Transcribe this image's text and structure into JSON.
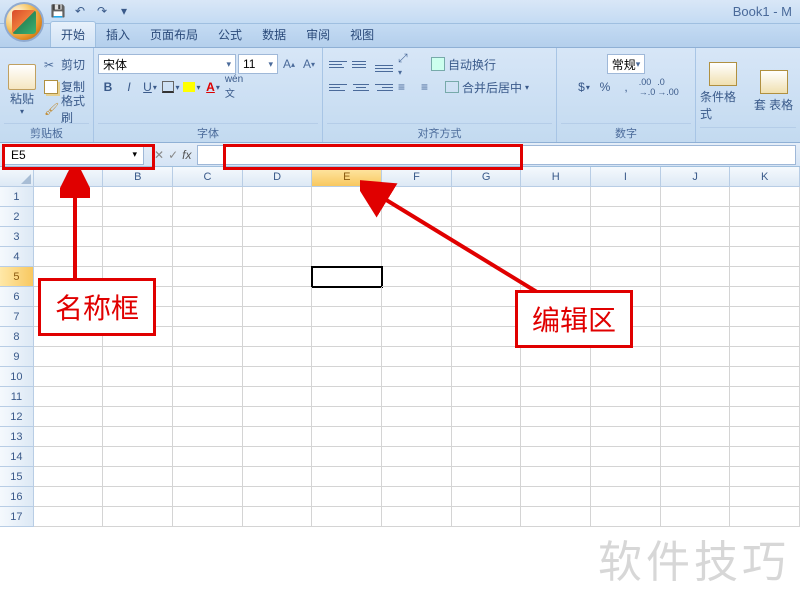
{
  "title": "Book1 - M",
  "tabs": [
    "开始",
    "插入",
    "页面布局",
    "公式",
    "数据",
    "审阅",
    "视图"
  ],
  "clipboard": {
    "cut": "剪切",
    "copy": "复制",
    "format_painter": "格式刷",
    "paste": "粘贴",
    "group": "剪贴板"
  },
  "font": {
    "name": "宋体",
    "size": "11",
    "group": "字体"
  },
  "align": {
    "wrap": "自动换行",
    "merge": "合并后居中",
    "group": "对齐方式"
  },
  "number": {
    "format": "常规",
    "group": "数字"
  },
  "styles": {
    "cond": "条件格式",
    "table_style": "套\n表格",
    "group": ""
  },
  "namebox": "E5",
  "columns": [
    "A",
    "B",
    "C",
    "D",
    "E",
    "F",
    "G",
    "H",
    "I",
    "J",
    "K"
  ],
  "row_count": 17,
  "active": {
    "row": 5,
    "col": "E",
    "colIndex": 4
  },
  "annotations": {
    "namebox_label": "名称框",
    "editor_label": "编辑区"
  },
  "watermark": "软件技巧"
}
